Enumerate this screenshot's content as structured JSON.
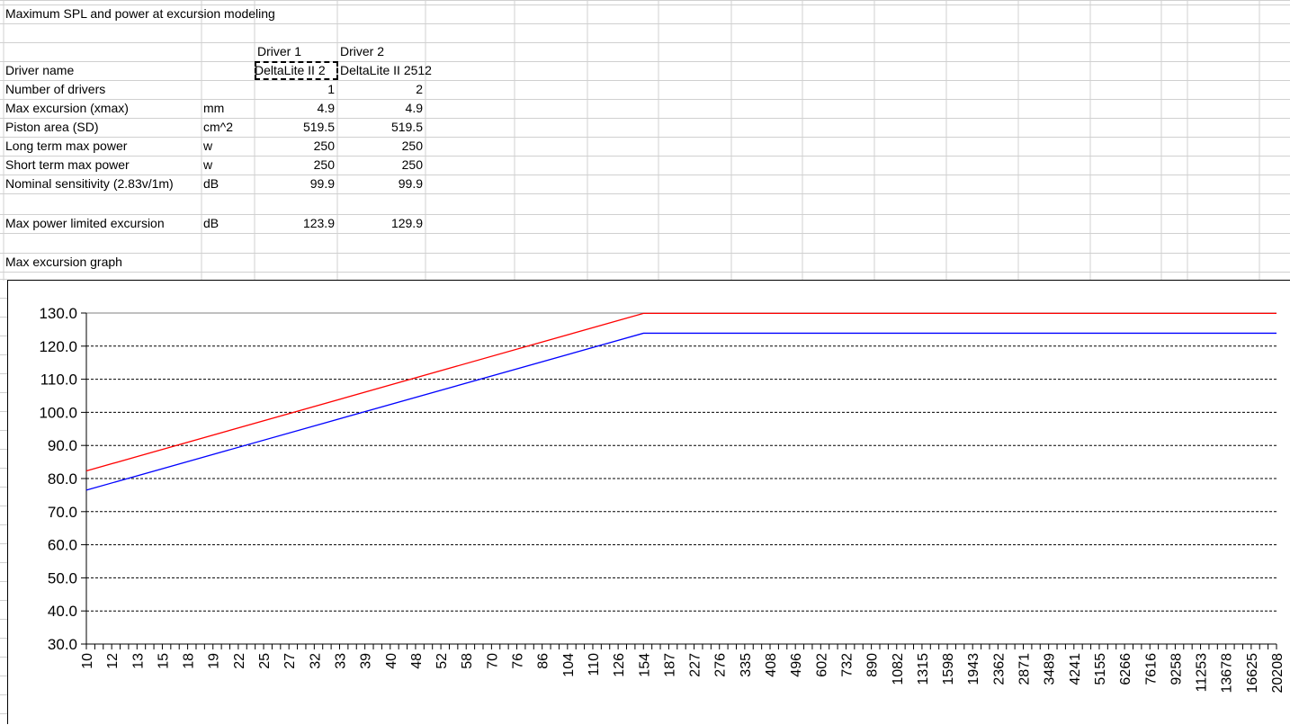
{
  "sheet": {
    "title": "Maximum SPL and power at excursion modeling",
    "driver1_header": "Driver 1",
    "driver2_header": "Driver 2",
    "rows": [
      {
        "label": "Driver name",
        "unit": "",
        "d1": "DeltaLite II 2",
        "d2": "DeltaLite II 2512"
      },
      {
        "label": "Number of drivers",
        "unit": "",
        "d1": "1",
        "d2": "2"
      },
      {
        "label": "Max excursion (xmax)",
        "unit": "mm",
        "d1": "4.9",
        "d2": "4.9"
      },
      {
        "label": "Piston area (SD)",
        "unit": "cm^2",
        "d1": "519.5",
        "d2": "519.5"
      },
      {
        "label": "Long term max power",
        "unit": "w",
        "d1": "250",
        "d2": "250"
      },
      {
        "label": "Short term max power",
        "unit": "w",
        "d1": "250",
        "d2": "250"
      },
      {
        "label": "Nominal sensitivity (2.83v/1m)",
        "unit": "dB",
        "d1": "99.9",
        "d2": "99.9"
      }
    ],
    "limit_row": {
      "label": "Max power limited excursion",
      "unit": "dB",
      "d1": "123.9",
      "d2": "129.9"
    },
    "graph_label": "Max excursion graph"
  },
  "chart_data": {
    "type": "line",
    "title": "",
    "xlabel": "",
    "ylabel": "",
    "ylim": [
      30,
      130
    ],
    "yticks": [
      "130.0",
      "120.0",
      "110.0",
      "100.0",
      "90.0",
      "80.0",
      "70.0",
      "60.0",
      "50.0",
      "40.0",
      "30.0"
    ],
    "grid": "dashed horizontal",
    "x_tick_labels": [
      "10",
      "12",
      "13",
      "15",
      "18",
      "19",
      "22",
      "25",
      "27",
      "32",
      "33",
      "39",
      "40",
      "48",
      "52",
      "58",
      "70",
      "76",
      "86",
      "104",
      "110",
      "126",
      "154",
      "187",
      "227",
      "276",
      "335",
      "408",
      "496",
      "602",
      "732",
      "890",
      "1082",
      "1315",
      "1598",
      "1943",
      "2362",
      "2871",
      "3489",
      "4241",
      "5155",
      "6266",
      "7616",
      "9258",
      "11253",
      "13678",
      "16625",
      "20208"
    ],
    "break_frequency": 154,
    "series": [
      {
        "color": "#ff0000",
        "values_at_break": {
          "start": 82.3,
          "plateau": 129.9
        }
      },
      {
        "color": "#0000ff",
        "values_at_break": {
          "start": 76.5,
          "plateau": 123.9
        }
      }
    ]
  }
}
